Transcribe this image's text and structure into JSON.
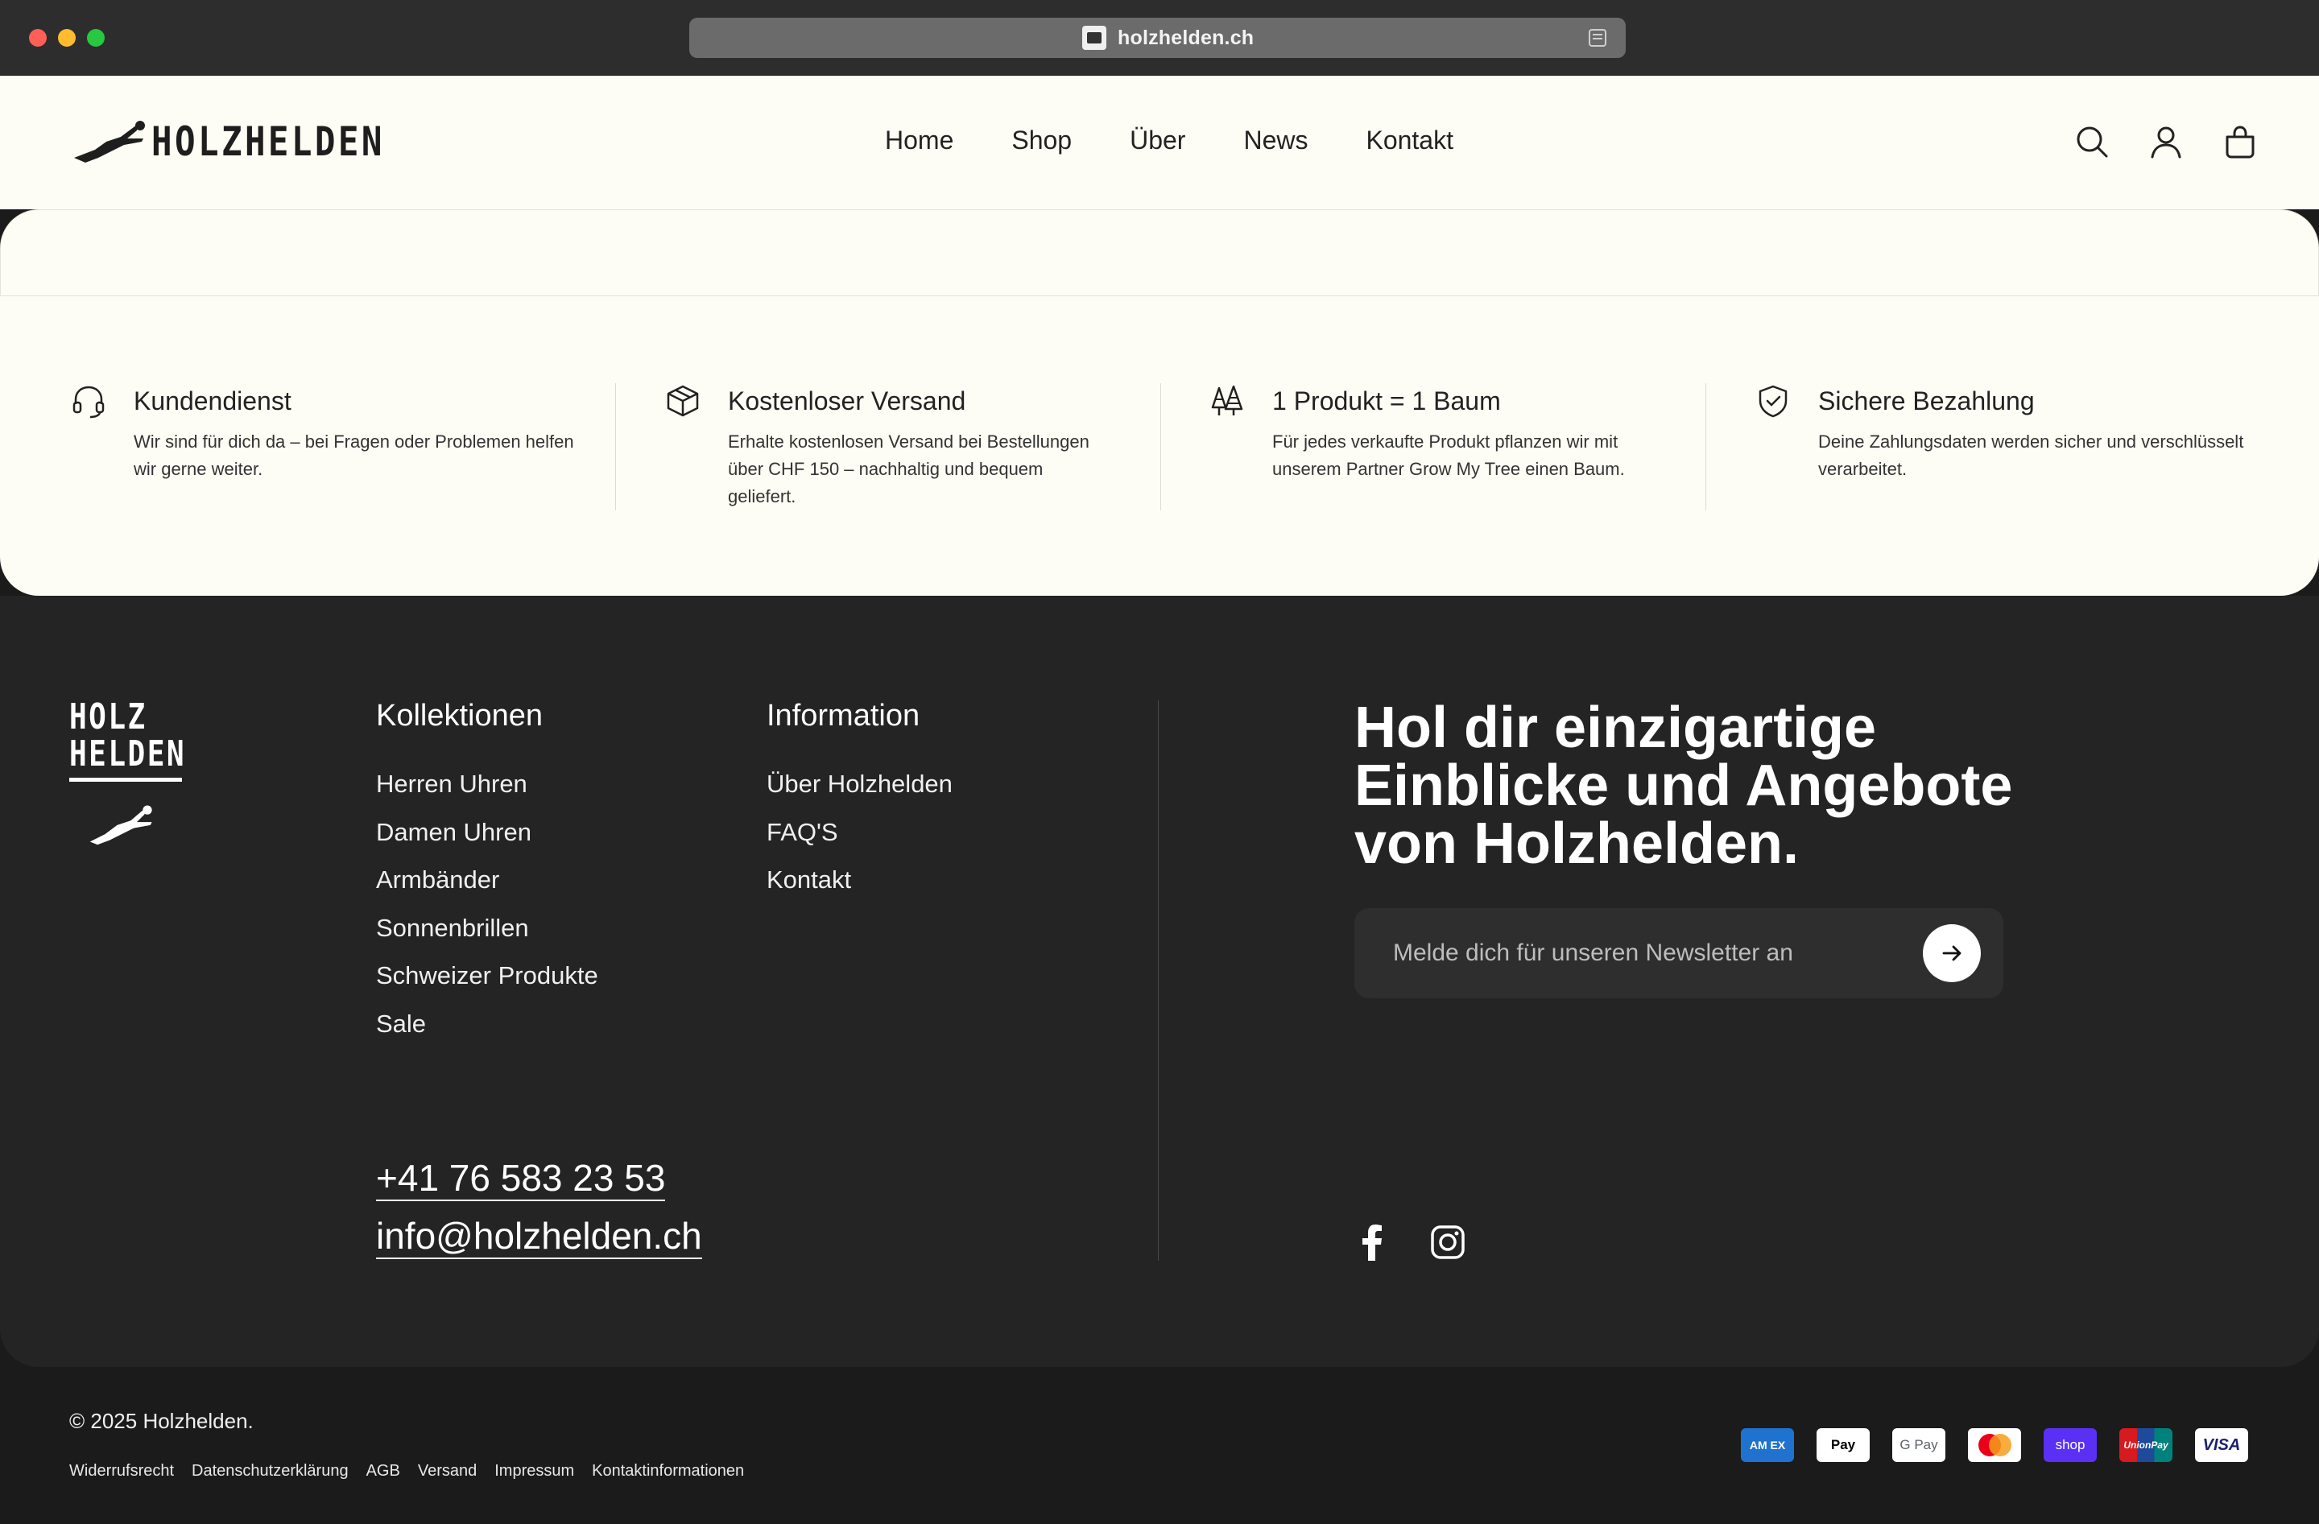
{
  "browser": {
    "url": "holzhelden.ch"
  },
  "header": {
    "logo_text": "HOLZHELDEN",
    "nav": [
      {
        "label": "Home"
      },
      {
        "label": "Shop"
      },
      {
        "label": "Über"
      },
      {
        "label": "News"
      },
      {
        "label": "Kontakt"
      }
    ],
    "icons": [
      "search-icon",
      "account-icon",
      "cart-icon"
    ]
  },
  "features": [
    {
      "icon": "headset-icon",
      "title": "Kundendienst",
      "text": "Wir sind für dich da – bei Fragen oder Problemen helfen wir gerne weiter."
    },
    {
      "icon": "package-icon",
      "title": "Kostenloser Versand",
      "text": "Erhalte kostenlosen Versand bei Bestellungen über CHF 150 – nachhaltig und bequem geliefert."
    },
    {
      "icon": "trees-icon",
      "title": "1 Produkt = 1 Baum",
      "text": "Für jedes verkaufte Produkt pflanzen wir mit unserem Partner Grow My Tree einen Baum."
    },
    {
      "icon": "shield-check-icon",
      "title": "Sichere Bezahlung",
      "text": "Deine Zahlungsdaten werden sicher und verschlüsselt verarbeitet."
    }
  ],
  "footer": {
    "logo_lines": [
      "HOLZ",
      "HELDEN"
    ],
    "collections": {
      "title": "Kollektionen",
      "items": [
        "Herren Uhren",
        "Damen Uhren",
        "Armbänder",
        "Sonnenbrillen",
        "Schweizer Produkte",
        "Sale"
      ]
    },
    "information": {
      "title": "Information",
      "items": [
        "Über Holzhelden",
        "FAQ'S",
        "Kontakt"
      ]
    },
    "contact": {
      "phone": "+41 76 583 23 53",
      "email": "info@holzhelden.ch"
    },
    "newsletter": {
      "headline": "Hol dir einzigartige Einblicke und Angebote von Holzhelden.",
      "placeholder": "Melde dich für unseren Newsletter an"
    },
    "social": [
      "facebook-icon",
      "instagram-icon"
    ]
  },
  "bottom": {
    "copyright": "© 2025 Holzhelden.",
    "legal_links": [
      "Widerrufsrecht",
      "Datenschutzerklärung",
      "AGB",
      "Versand",
      "Impressum",
      "Kontaktinformationen"
    ],
    "payments": [
      {
        "id": "amex",
        "label": "AM EX"
      },
      {
        "id": "apple",
        "label": " Pay"
      },
      {
        "id": "gpay",
        "label": "G Pay"
      },
      {
        "id": "mc",
        "label": ""
      },
      {
        "id": "shop",
        "label": "shop"
      },
      {
        "id": "union",
        "label": "UnionPay"
      },
      {
        "id": "visa",
        "label": "VISA"
      }
    ]
  }
}
